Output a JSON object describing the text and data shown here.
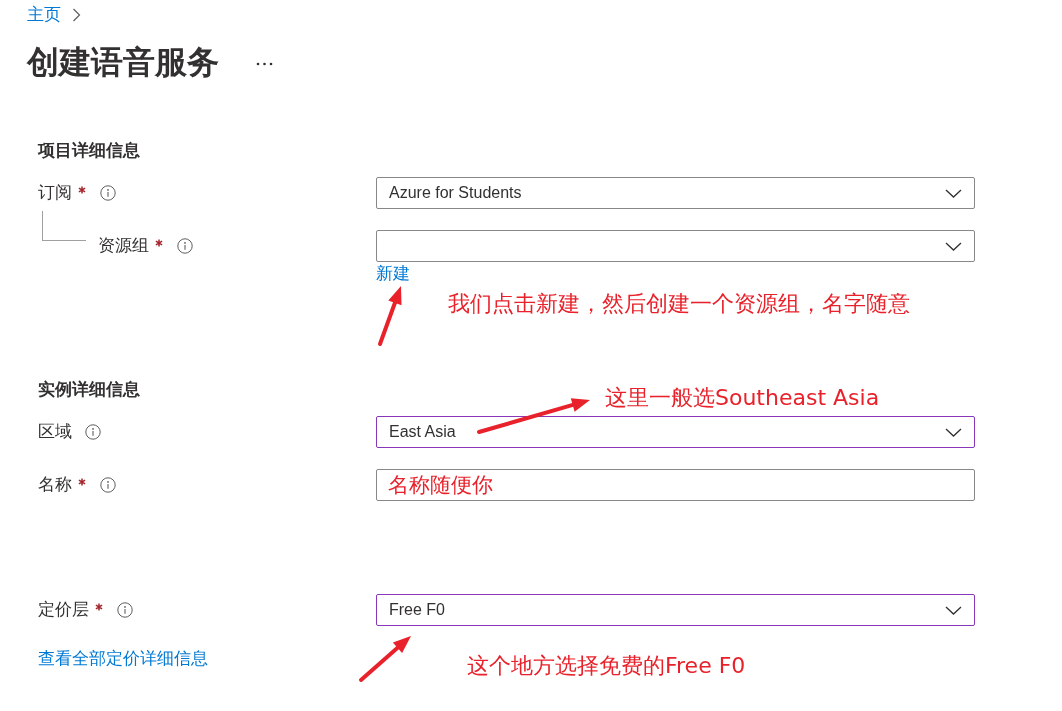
{
  "breadcrumb": [
    {
      "label": "主页"
    }
  ],
  "page_title": "创建语音服务",
  "sections": [
    {
      "heading": "项目详细信息",
      "fields": [
        {
          "label": "订阅",
          "required": true,
          "kind": "dropdown",
          "value": "Azure for Students",
          "modified": false,
          "children": [
            {
              "label": "资源组",
              "required": true,
              "kind": "dropdown",
              "modified": false,
              "link": "新建"
            }
          ]
        }
      ]
    },
    {
      "heading": "实例详细信息",
      "fields": [
        {
          "label": "区域",
          "required": false,
          "kind": "dropdown",
          "value": "East Asia",
          "modified": true
        },
        {
          "label": "名称",
          "required": true,
          "kind": "textbox",
          "value": "名称随便你",
          "modified": false,
          "annotated": true
        }
      ]
    },
    {
      "fields": [
        {
          "label": "定价层",
          "required": true,
          "kind": "dropdown",
          "value": "Free F0",
          "modified": true
        }
      ],
      "link": "查看全部定价详细信息"
    }
  ],
  "annotations": [
    {
      "text": "我们点击新建，然后创建一个资源组，名字随意"
    },
    {
      "text": "这里一般选Southeast Asia"
    },
    {
      "text": "这个地方选择免费的Free F0"
    }
  ]
}
